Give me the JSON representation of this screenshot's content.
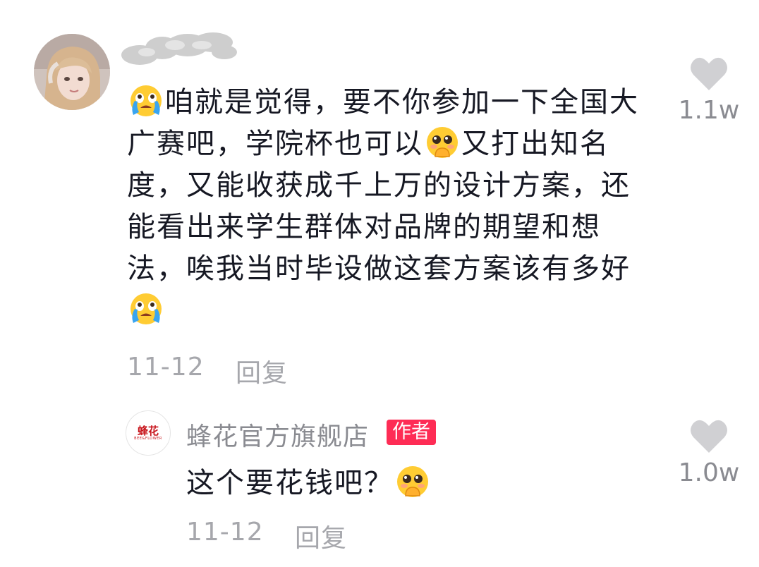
{
  "comment": {
    "text_segments": [
      "咱就是觉得，要不你参加一下全国大广赛吧，学院杯也可以",
      "又打出知名度，又能收获成千上万的设计方案，还能看出来学生群体对品牌的期望和想法，唉我当时毕设做这套方案该有多好"
    ],
    "emojis": [
      "crying-face-emoji",
      "pleading-face-emoji",
      "crying-face-emoji"
    ],
    "date": "11-12",
    "reply_label": "回复",
    "like_count": "1.1w"
  },
  "reply": {
    "author_name": "蜂花官方旗舰店",
    "author_badge": "作者",
    "logo_text": "蜂花",
    "logo_subtext": "BEE&FLOWER",
    "text": "这个要花钱吧？",
    "emoji": "pleading-face-emoji",
    "date": "11-12",
    "reply_label": "回复",
    "like_count": "1.0w"
  },
  "colors": {
    "text": "#161823",
    "meta": "#a6a7ac",
    "like_icon": "#d0d0d3",
    "author_badge": "#fe2c55",
    "brand_red": "#c8161d"
  }
}
